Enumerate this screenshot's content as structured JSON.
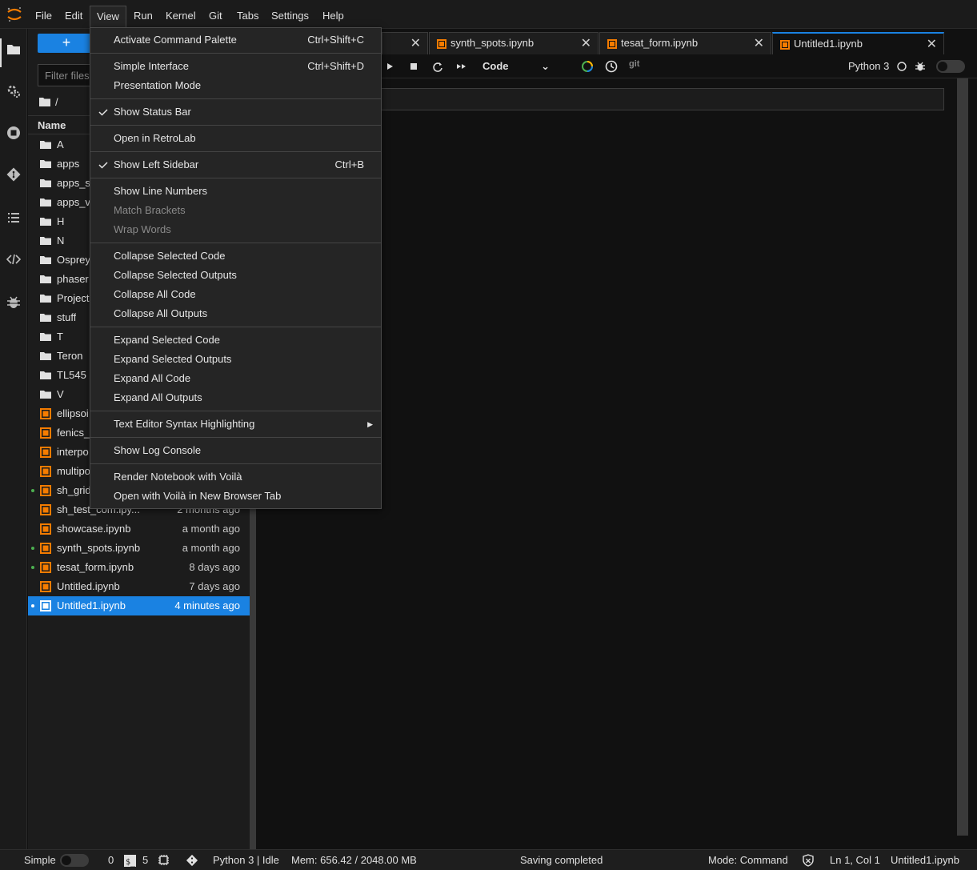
{
  "menubar": {
    "items": [
      "File",
      "Edit",
      "View",
      "Run",
      "Kernel",
      "Git",
      "Tabs",
      "Settings",
      "Help"
    ],
    "active": "View"
  },
  "filebrowser": {
    "new_label": "+",
    "filter_placeholder": "Filter files by name",
    "breadcrumb": "/",
    "name_header": "Name",
    "files": [
      {
        "name": "A",
        "type": "folder",
        "modified": "",
        "running": false
      },
      {
        "name": "apps",
        "type": "folder",
        "modified": "",
        "running": false
      },
      {
        "name": "apps_st",
        "type": "folder",
        "modified": "",
        "running": false
      },
      {
        "name": "apps_vo",
        "type": "folder",
        "modified": "",
        "running": false
      },
      {
        "name": "H",
        "type": "folder",
        "modified": "",
        "running": false
      },
      {
        "name": "N",
        "type": "folder",
        "modified": "",
        "running": false
      },
      {
        "name": "Osprey",
        "type": "folder",
        "modified": "",
        "running": false
      },
      {
        "name": "phaser",
        "type": "folder",
        "modified": "",
        "running": false
      },
      {
        "name": "Projects",
        "type": "folder",
        "modified": "",
        "running": false
      },
      {
        "name": "stuff",
        "type": "folder",
        "modified": "",
        "running": false
      },
      {
        "name": "T",
        "type": "folder",
        "modified": "",
        "running": false
      },
      {
        "name": "Teron",
        "type": "folder",
        "modified": "",
        "running": false
      },
      {
        "name": "TL545",
        "type": "folder",
        "modified": "",
        "running": false
      },
      {
        "name": "V",
        "type": "folder",
        "modified": "",
        "running": false
      },
      {
        "name": "ellipsoi",
        "type": "notebook",
        "modified": "",
        "running": false
      },
      {
        "name": "fenics_t",
        "type": "notebook",
        "modified": "",
        "running": false
      },
      {
        "name": "interpo",
        "type": "notebook",
        "modified": "",
        "running": false
      },
      {
        "name": "multipo",
        "type": "notebook",
        "modified": "",
        "running": false
      },
      {
        "name": "sh_grid",
        "type": "notebook",
        "modified": "",
        "running": true
      },
      {
        "name": "sh_test_com.ipy...",
        "type": "notebook",
        "modified": "2 months ago",
        "running": false
      },
      {
        "name": "showcase.ipynb",
        "type": "notebook",
        "modified": "a month ago",
        "running": false
      },
      {
        "name": "synth_spots.ipynb",
        "type": "notebook",
        "modified": "a month ago",
        "running": true
      },
      {
        "name": "tesat_form.ipynb",
        "type": "notebook",
        "modified": "8 days ago",
        "running": true
      },
      {
        "name": "Untitled.ipynb",
        "type": "notebook",
        "modified": "7 days ago",
        "running": false
      },
      {
        "name": "Untitled1.ipynb",
        "type": "notebook",
        "modified": "4 minutes ago",
        "running": true,
        "selected": true
      }
    ]
  },
  "tabs": [
    {
      "label": "",
      "active": false
    },
    {
      "label": "synth_spots.ipynb",
      "active": false
    },
    {
      "label": "tesat_form.ipynb",
      "active": false
    },
    {
      "label": "Untitled1.ipynb",
      "active": true
    }
  ],
  "toolbar": {
    "cell_type": "Code",
    "git_label": "git",
    "kernel_name": "Python 3"
  },
  "view_menu": {
    "groups": [
      [
        {
          "label": "Activate Command Palette",
          "shortcut": "Ctrl+Shift+C"
        }
      ],
      [
        {
          "label": "Simple Interface",
          "shortcut": "Ctrl+Shift+D"
        },
        {
          "label": "Presentation Mode",
          "shortcut": ""
        }
      ],
      [
        {
          "label": "Show Status Bar",
          "shortcut": "",
          "checked": true
        }
      ],
      [
        {
          "label": "Open in RetroLab",
          "shortcut": ""
        }
      ],
      [
        {
          "label": "Show Left Sidebar",
          "shortcut": "Ctrl+B",
          "checked": true
        }
      ],
      [
        {
          "label": "Show Line Numbers",
          "shortcut": ""
        },
        {
          "label": "Match Brackets",
          "shortcut": "",
          "disabled": true
        },
        {
          "label": "Wrap Words",
          "shortcut": "",
          "disabled": true
        }
      ],
      [
        {
          "label": "Collapse Selected Code",
          "shortcut": ""
        },
        {
          "label": "Collapse Selected Outputs",
          "shortcut": ""
        },
        {
          "label": "Collapse All Code",
          "shortcut": ""
        },
        {
          "label": "Collapse All Outputs",
          "shortcut": ""
        }
      ],
      [
        {
          "label": "Expand Selected Code",
          "shortcut": ""
        },
        {
          "label": "Expand Selected Outputs",
          "shortcut": ""
        },
        {
          "label": "Expand All Code",
          "shortcut": ""
        },
        {
          "label": "Expand All Outputs",
          "shortcut": ""
        }
      ],
      [
        {
          "label": "Text Editor Syntax Highlighting",
          "shortcut": "",
          "submenu": true
        }
      ],
      [
        {
          "label": "Show Log Console",
          "shortcut": ""
        }
      ],
      [
        {
          "label": "Render Notebook with Voilà",
          "shortcut": ""
        },
        {
          "label": "Open with Voilà in New Browser Tab",
          "shortcut": ""
        }
      ]
    ]
  },
  "statusbar": {
    "mode_label": "Simple",
    "terminals": "0",
    "kernels": "5",
    "kernel_status": "Python 3 | Idle",
    "memory": "Mem: 656.42 / 2048.00 MB",
    "message": "Saving completed",
    "mode": "Mode: Command",
    "cursor": "Ln 1, Col 1",
    "filename": "Untitled1.ipynb"
  },
  "colors": {
    "accent": "#1a82e2",
    "notebook_icon": "#f57c00",
    "running": "#4caf50"
  }
}
